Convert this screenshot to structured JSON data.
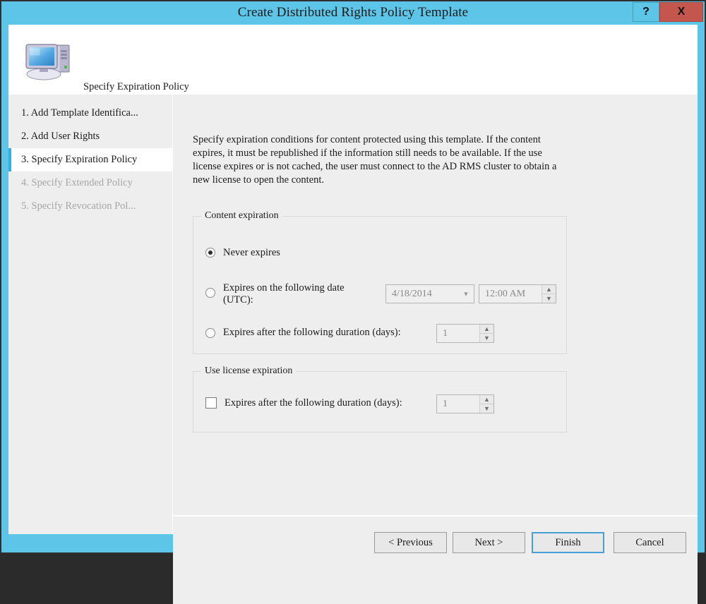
{
  "window": {
    "title": "Create Distributed Rights Policy Template",
    "help_label": "?",
    "close_label": "X"
  },
  "header": {
    "icon": "computer-icon",
    "subtitle": "Specify Expiration Policy"
  },
  "sidebar": {
    "items": [
      {
        "label": "1. Add Template Identifica...",
        "state": "normal"
      },
      {
        "label": "2. Add User Rights",
        "state": "normal"
      },
      {
        "label": "3. Specify Expiration Policy",
        "state": "active"
      },
      {
        "label": "4. Specify Extended Policy",
        "state": "disabled"
      },
      {
        "label": "5. Specify Revocation Pol...",
        "state": "disabled"
      }
    ]
  },
  "content": {
    "description": "Specify expiration conditions for content protected using this template. If the content expires, it must be republished if the information still needs to be available. If the use license expires or is not cached, the user must connect to the AD RMS cluster to obtain a new license to open the content.",
    "content_expiration": {
      "legend": "Content expiration",
      "never_expires_label": "Never expires",
      "expires_on_date_label": "Expires on the following date (UTC):",
      "date_value": "4/18/2014",
      "time_value": "12:00 AM",
      "expires_after_label": "Expires after the following duration (days):",
      "duration_value": "1"
    },
    "use_license_expiration": {
      "legend": "Use license expiration",
      "expires_after_label": "Expires after the following duration (days):",
      "duration_value": "1"
    }
  },
  "footer": {
    "previous_label": "< Previous",
    "next_label": "Next >",
    "finish_label": "Finish",
    "cancel_label": "Cancel"
  },
  "colors": {
    "titlebar": "#5cc5e8",
    "close_button": "#c4564e",
    "accent": "#31b0e0",
    "panel": "#eeeeee"
  }
}
